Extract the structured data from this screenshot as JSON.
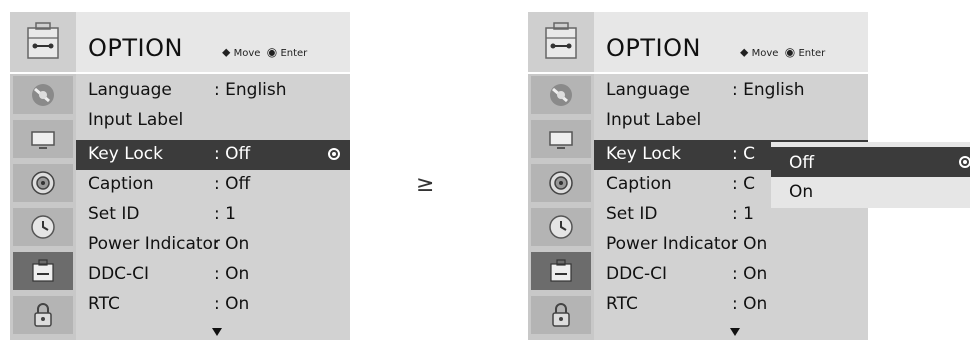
{
  "header": {
    "title": "OPTION",
    "nav_move_symbol": "⬥",
    "nav_move": "Move",
    "nav_enter_symbol": "◉",
    "nav_enter": "Enter"
  },
  "menu_left": {
    "rows": [
      {
        "label": "Language",
        "value": ": English"
      },
      {
        "label": "Input Label",
        "value": ""
      },
      {
        "label": "Key Lock",
        "value": ": Off"
      },
      {
        "label": "Caption",
        "value": ": Off"
      },
      {
        "label": "Set ID",
        "value": ": 1"
      },
      {
        "label": "Power Indicator",
        "value": ": On"
      },
      {
        "label": "DDC-CI",
        "value": ": On"
      },
      {
        "label": "RTC",
        "value": ": On"
      }
    ]
  },
  "menu_right": {
    "rows": [
      {
        "label": "Language",
        "value": ": English"
      },
      {
        "label": "Input Label",
        "value": ""
      },
      {
        "label": "Key Lock",
        "value": ": C"
      },
      {
        "label": "Caption",
        "value": ": C"
      },
      {
        "label": "Set ID",
        "value": ": 1"
      },
      {
        "label": "Power Indicator",
        "value": ": On"
      },
      {
        "label": "DDC-CI",
        "value": ": On"
      },
      {
        "label": "RTC",
        "value": ": On"
      }
    ]
  },
  "popup": {
    "options": [
      "Off",
      "On"
    ],
    "selected": "Off"
  },
  "step_symbol": "≥",
  "icons": [
    "picture-icon",
    "screen-icon",
    "audio-icon",
    "time-icon",
    "option-icon",
    "lock-icon"
  ]
}
